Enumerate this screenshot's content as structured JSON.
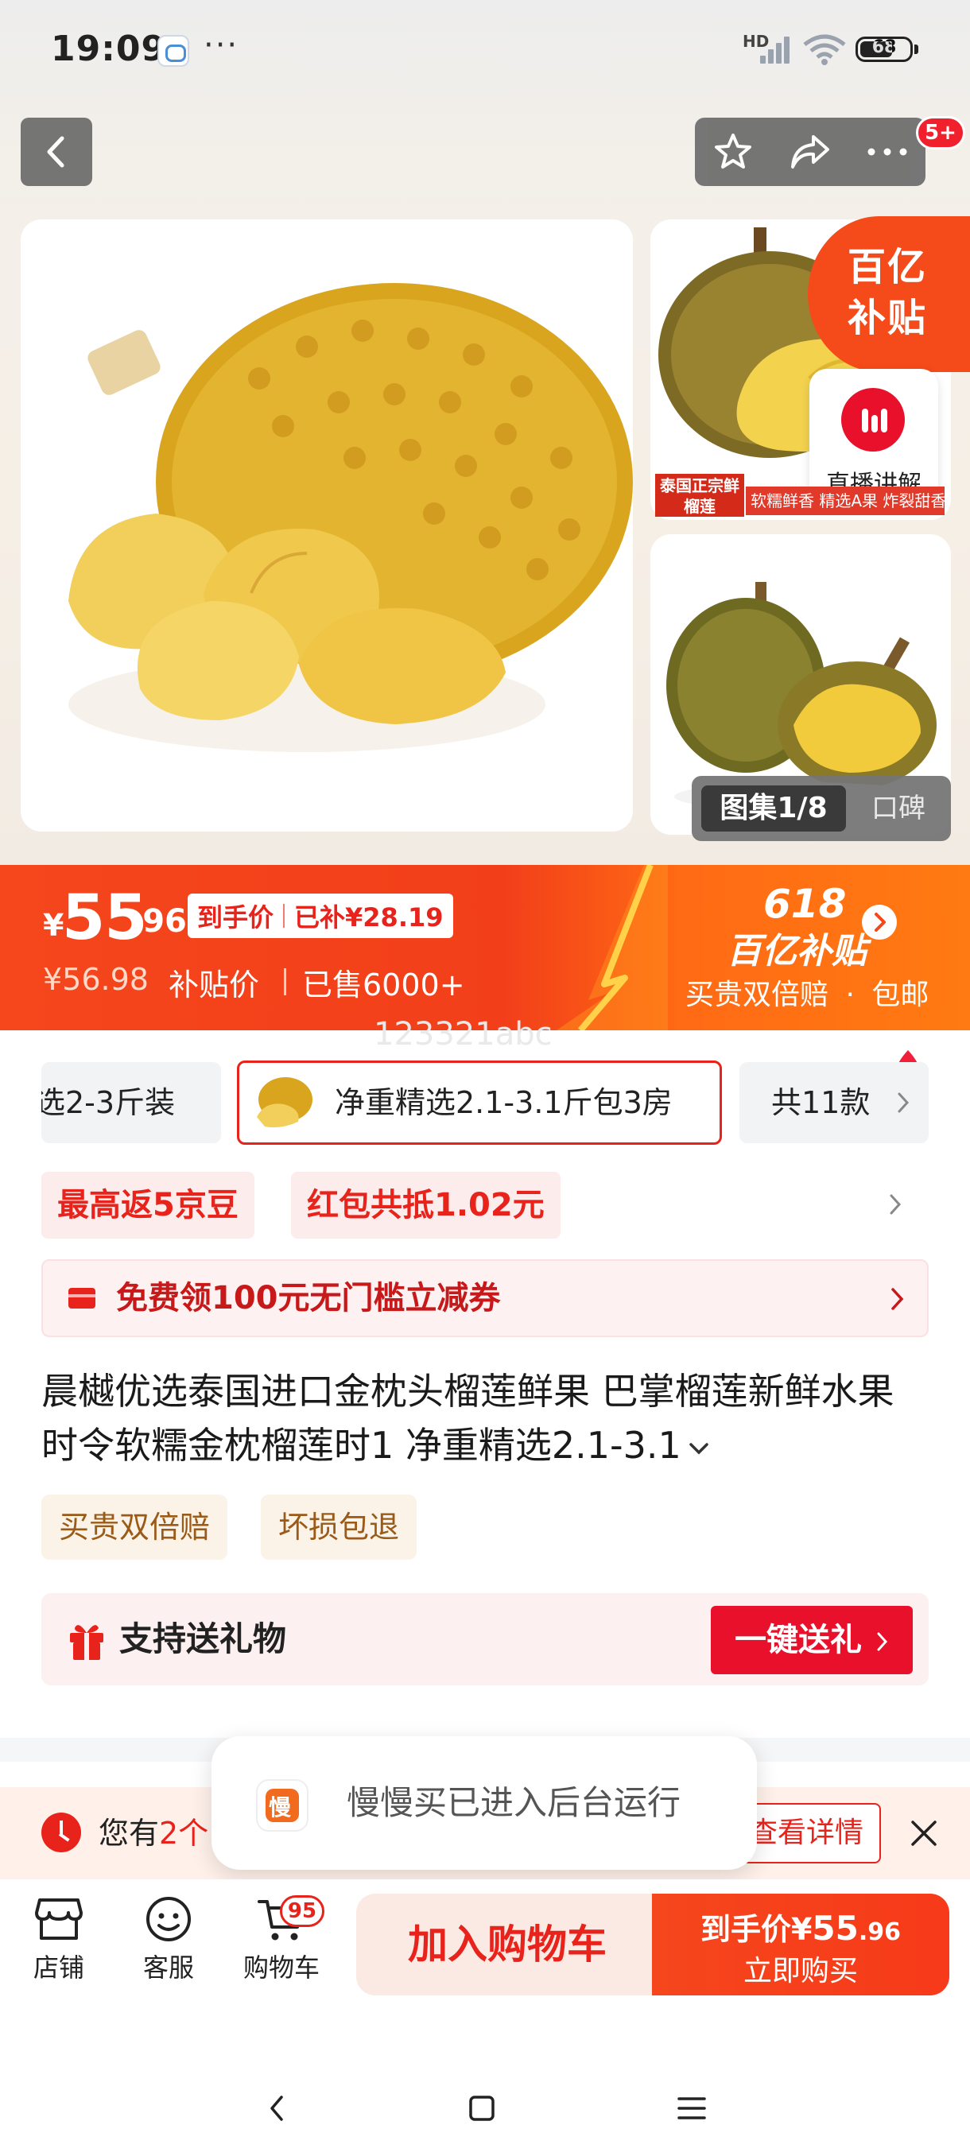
{
  "status_bar": {
    "time": "19:09",
    "more": "···",
    "network": "HD",
    "battery": "68"
  },
  "header": {
    "back_icon": "chevron-left-icon",
    "favorite_icon": "star-icon",
    "share_icon": "share-icon",
    "more_icon": "more-dots-icon",
    "message_badge": "5+"
  },
  "gallery": {
    "subsidy_badge_line1": "百亿",
    "subsidy_badge_line2": "补贴",
    "live_label": "直播讲解",
    "thumb_tag_a": "泰国正宗鲜榴莲",
    "thumb_tag_b": "软糯鲜香 精选A果 炸裂甜香",
    "gallery_tab": "图集1/8",
    "reputation_tab": "口碑"
  },
  "price": {
    "currency": "¥",
    "main": "55",
    "cents": ".96",
    "tag_label": "到手价",
    "tag_subsidy": "已补¥28.19",
    "original": "¥56.98",
    "original_label": "补贴价",
    "sold": "已售6000+",
    "promo_618": "618",
    "promo_sub": "百亿补贴",
    "promo_bottom_a": "买贵双倍赔",
    "promo_bottom_sep": "·",
    "promo_bottom_b": "包邮",
    "watermark": "123321abc"
  },
  "variants": {
    "left_label": "选2-3斤装",
    "selected_label": "净重精选2.1-3.1斤包3房",
    "more_label": "共11款"
  },
  "coupons": [
    {
      "label": "最高返5京豆"
    },
    {
      "label": "红包共抵1.02元"
    }
  ],
  "voucher": {
    "label": "免费领100元无门槛立减券"
  },
  "product": {
    "title": "晨樾优选泰国进口金枕头榴莲鲜果 巴掌榴莲新鲜水果 时令软糯金枕榴莲时1 净重精选2.1-3.1",
    "guarantees": [
      "买贵双倍赔",
      "坏损包退"
    ]
  },
  "gift": {
    "label": "支持送礼物",
    "button": "一键送礼"
  },
  "reminder": {
    "text_prefix": "您有",
    "text_highlight": "2个",
    "button": "查看详情"
  },
  "toast": {
    "app_glyph": "慢",
    "text": "慢慢买已进入后台运行"
  },
  "bottom_bar": {
    "shop": "店铺",
    "service": "客服",
    "cart": "购物车",
    "cart_count": "95",
    "add_to_cart": "加入购物车",
    "buy_prefix": "到手价¥",
    "buy_price_int": "55",
    "buy_price_dec": ".96",
    "buy_now": "立即购买"
  },
  "colors": {
    "accent_red": "#e8231b",
    "banner_orange": "#f5461c",
    "guarantee_brown": "#9a5a18"
  }
}
